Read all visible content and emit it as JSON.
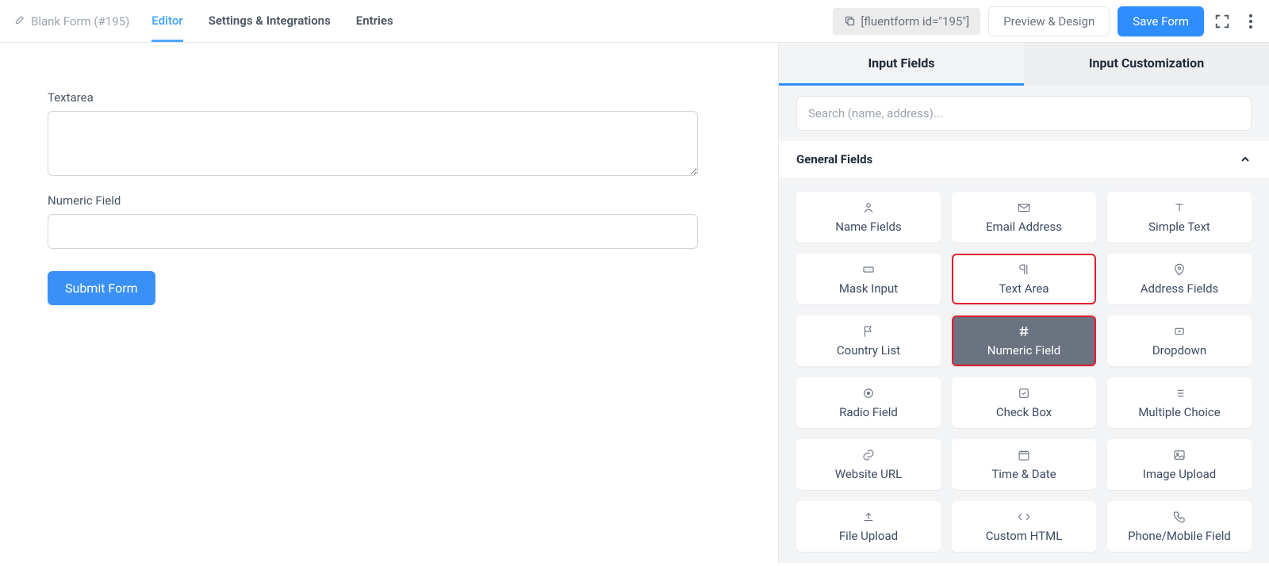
{
  "header": {
    "form_title": "Blank Form (#195)",
    "tabs": {
      "editor": "Editor",
      "settings": "Settings & Integrations",
      "entries": "Entries"
    },
    "shortcode": "[fluentform id=\"195\"]",
    "preview_btn": "Preview & Design",
    "save_btn": "Save Form"
  },
  "canvas": {
    "textarea_label": "Textarea",
    "numeric_label": "Numeric Field",
    "submit_label": "Submit Form"
  },
  "sidebar": {
    "tab_fields": "Input Fields",
    "tab_custom": "Input Customization",
    "search_placeholder": "Search (name, address)...",
    "section_general": "General Fields",
    "fields": {
      "name": "Name Fields",
      "email": "Email Address",
      "simple_text": "Simple Text",
      "mask": "Mask Input",
      "textarea": "Text Area",
      "address": "Address Fields",
      "country": "Country List",
      "numeric": "Numeric Field",
      "dropdown": "Dropdown",
      "radio": "Radio Field",
      "checkbox": "Check Box",
      "multi": "Multiple Choice",
      "url": "Website URL",
      "datetime": "Time & Date",
      "image": "Image Upload",
      "file": "File Upload",
      "html": "Custom HTML",
      "phone": "Phone/Mobile Field"
    }
  }
}
